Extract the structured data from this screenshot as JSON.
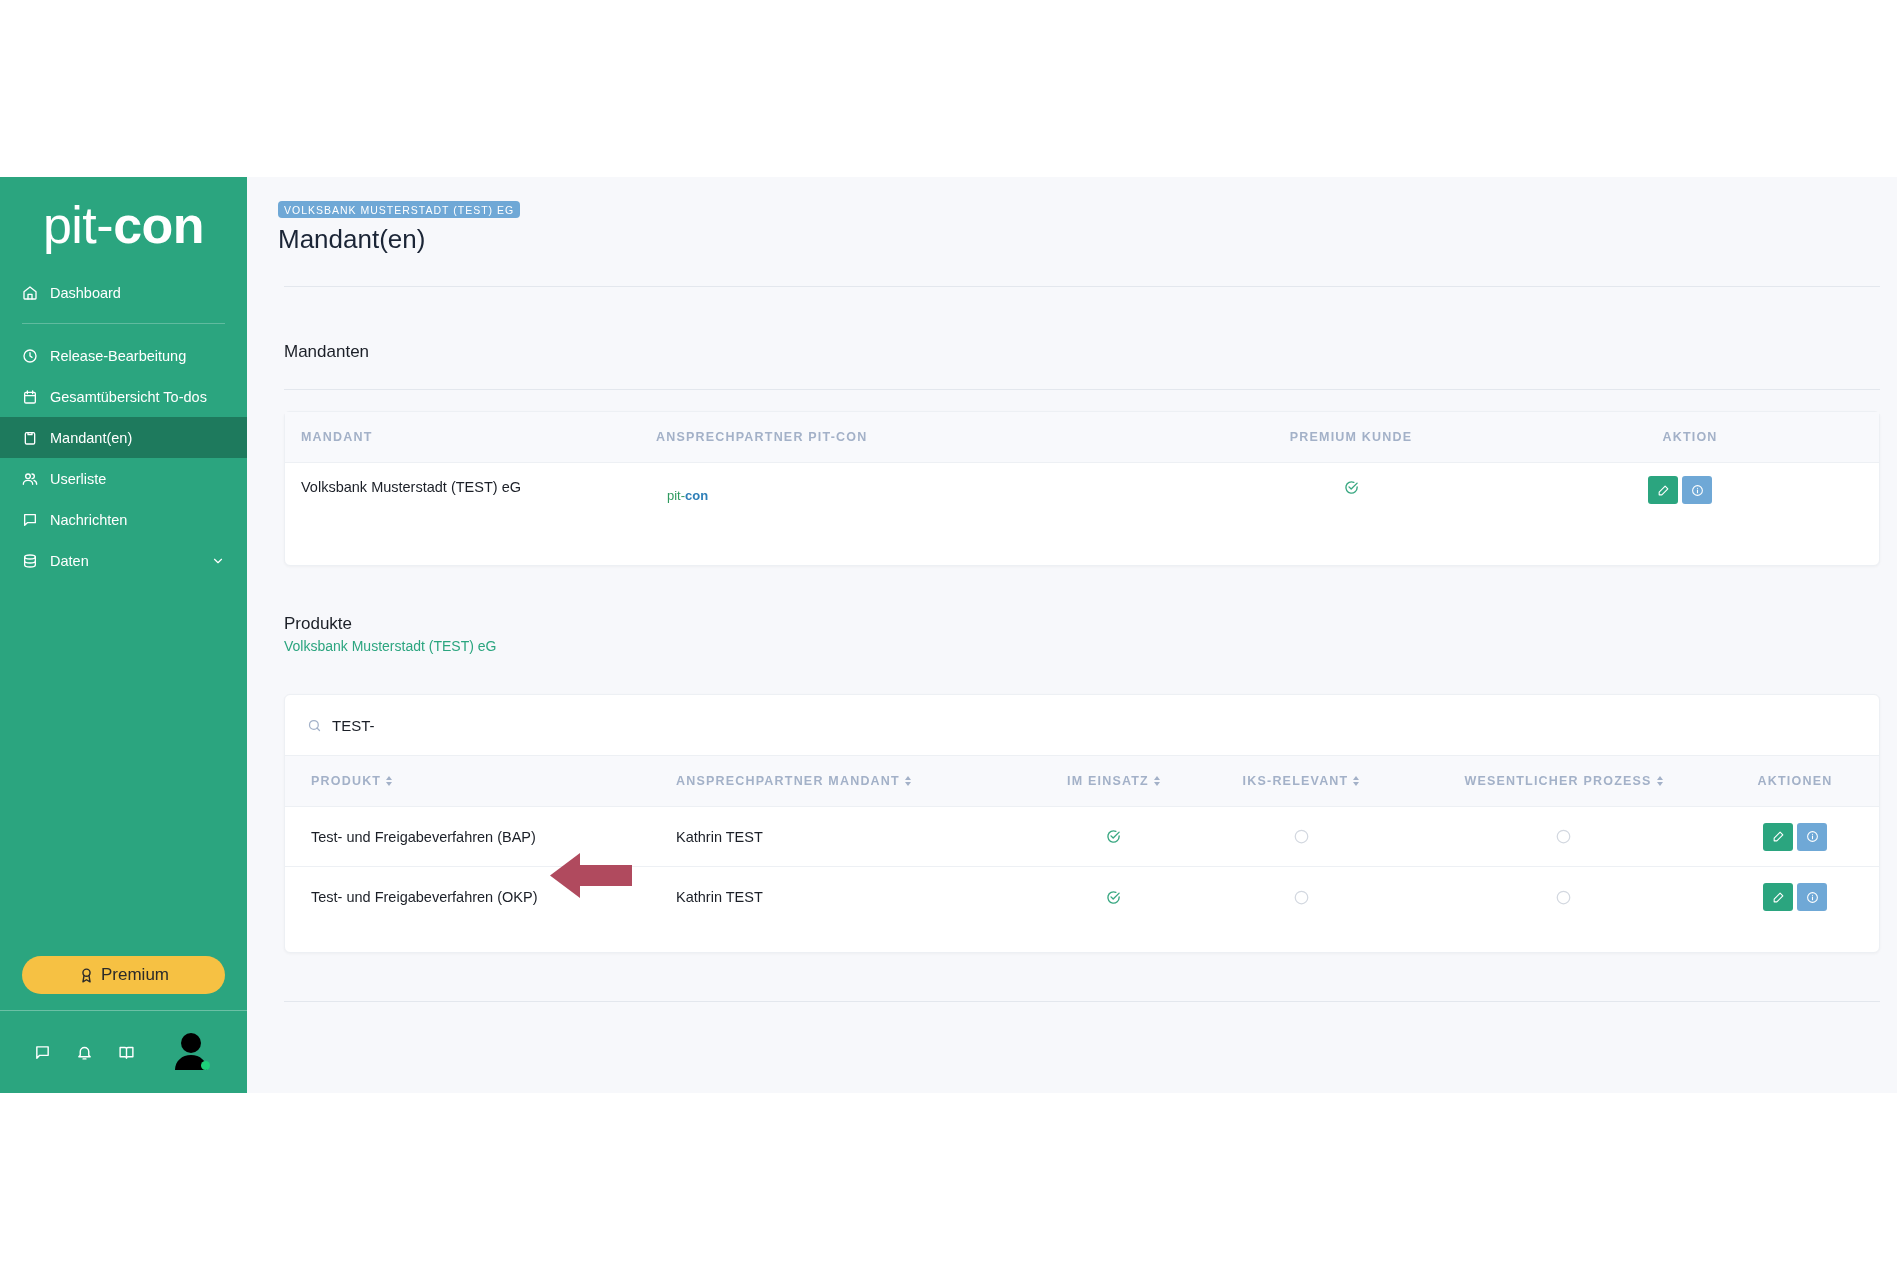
{
  "sidebar": {
    "logo": "pit-**con**",
    "groups": [
      [
        {
          "label": "Dashboard",
          "kind": "link",
          "selected": false
        }
      ],
      [
        {
          "label": "Release-Bearbeitung",
          "kind": "link",
          "selected": false
        },
        {
          "label": "Gesamtübersicht To-dos",
          "kind": "link",
          "selected": false
        },
        {
          "label": "Mandant(en)",
          "kind": "link",
          "selected": true
        },
        {
          "label": "Userliste",
          "kind": "link",
          "selected": false
        },
        {
          "label": "Nachrichten",
          "kind": "link",
          "selected": false
        },
        {
          "label": "Daten",
          "kind": "group",
          "selected": false,
          "expanded": false
        }
      ]
    ],
    "premium_button": "Premium",
    "user": {
      "online": true
    }
  },
  "header": {
    "badge": "VOLKSBANK MUSTERSTADT (TEST) EG",
    "title": "Mandant(en)"
  },
  "mandanten": {
    "title": "Mandanten",
    "columns": [
      "MANDANT",
      "ANSPRECHPARTNER PIT-CON",
      "PREMIUM KUNDE",
      "AKTION"
    ],
    "rows": [
      {
        "mandant": "Volksbank Musterstadt (TEST) eG",
        "contact_logo": "pit-**con**",
        "premium": true
      }
    ]
  },
  "produkte": {
    "title": "Produkte",
    "subtitle": "Volksbank Musterstadt (TEST) eG",
    "search": {
      "value": "TEST-"
    },
    "columns": [
      {
        "label": "PRODUKT",
        "sortable": true
      },
      {
        "label": "ANSPRECHPARTNER MANDANT",
        "sortable": true
      },
      {
        "label": "IM EINSATZ",
        "sortable": true
      },
      {
        "label": "IKS-RELEVANT",
        "sortable": true
      },
      {
        "label": "WESENTLICHER PROZESS",
        "sortable": true
      },
      {
        "label": "AKTIONEN",
        "sortable": false
      }
    ],
    "rows": [
      {
        "produkt": "Test- und Freigabeverfahren (BAP)",
        "ansprechpartner": "Kathrin TEST",
        "im_einsatz": true,
        "iks_relevant": false,
        "wesentlicher_prozess": false
      },
      {
        "produkt": "Test- und Freigabeverfahren (OKP)",
        "ansprechpartner": "Kathrin TEST",
        "im_einsatz": true,
        "iks_relevant": false,
        "wesentlicher_prozess": false
      }
    ]
  }
}
